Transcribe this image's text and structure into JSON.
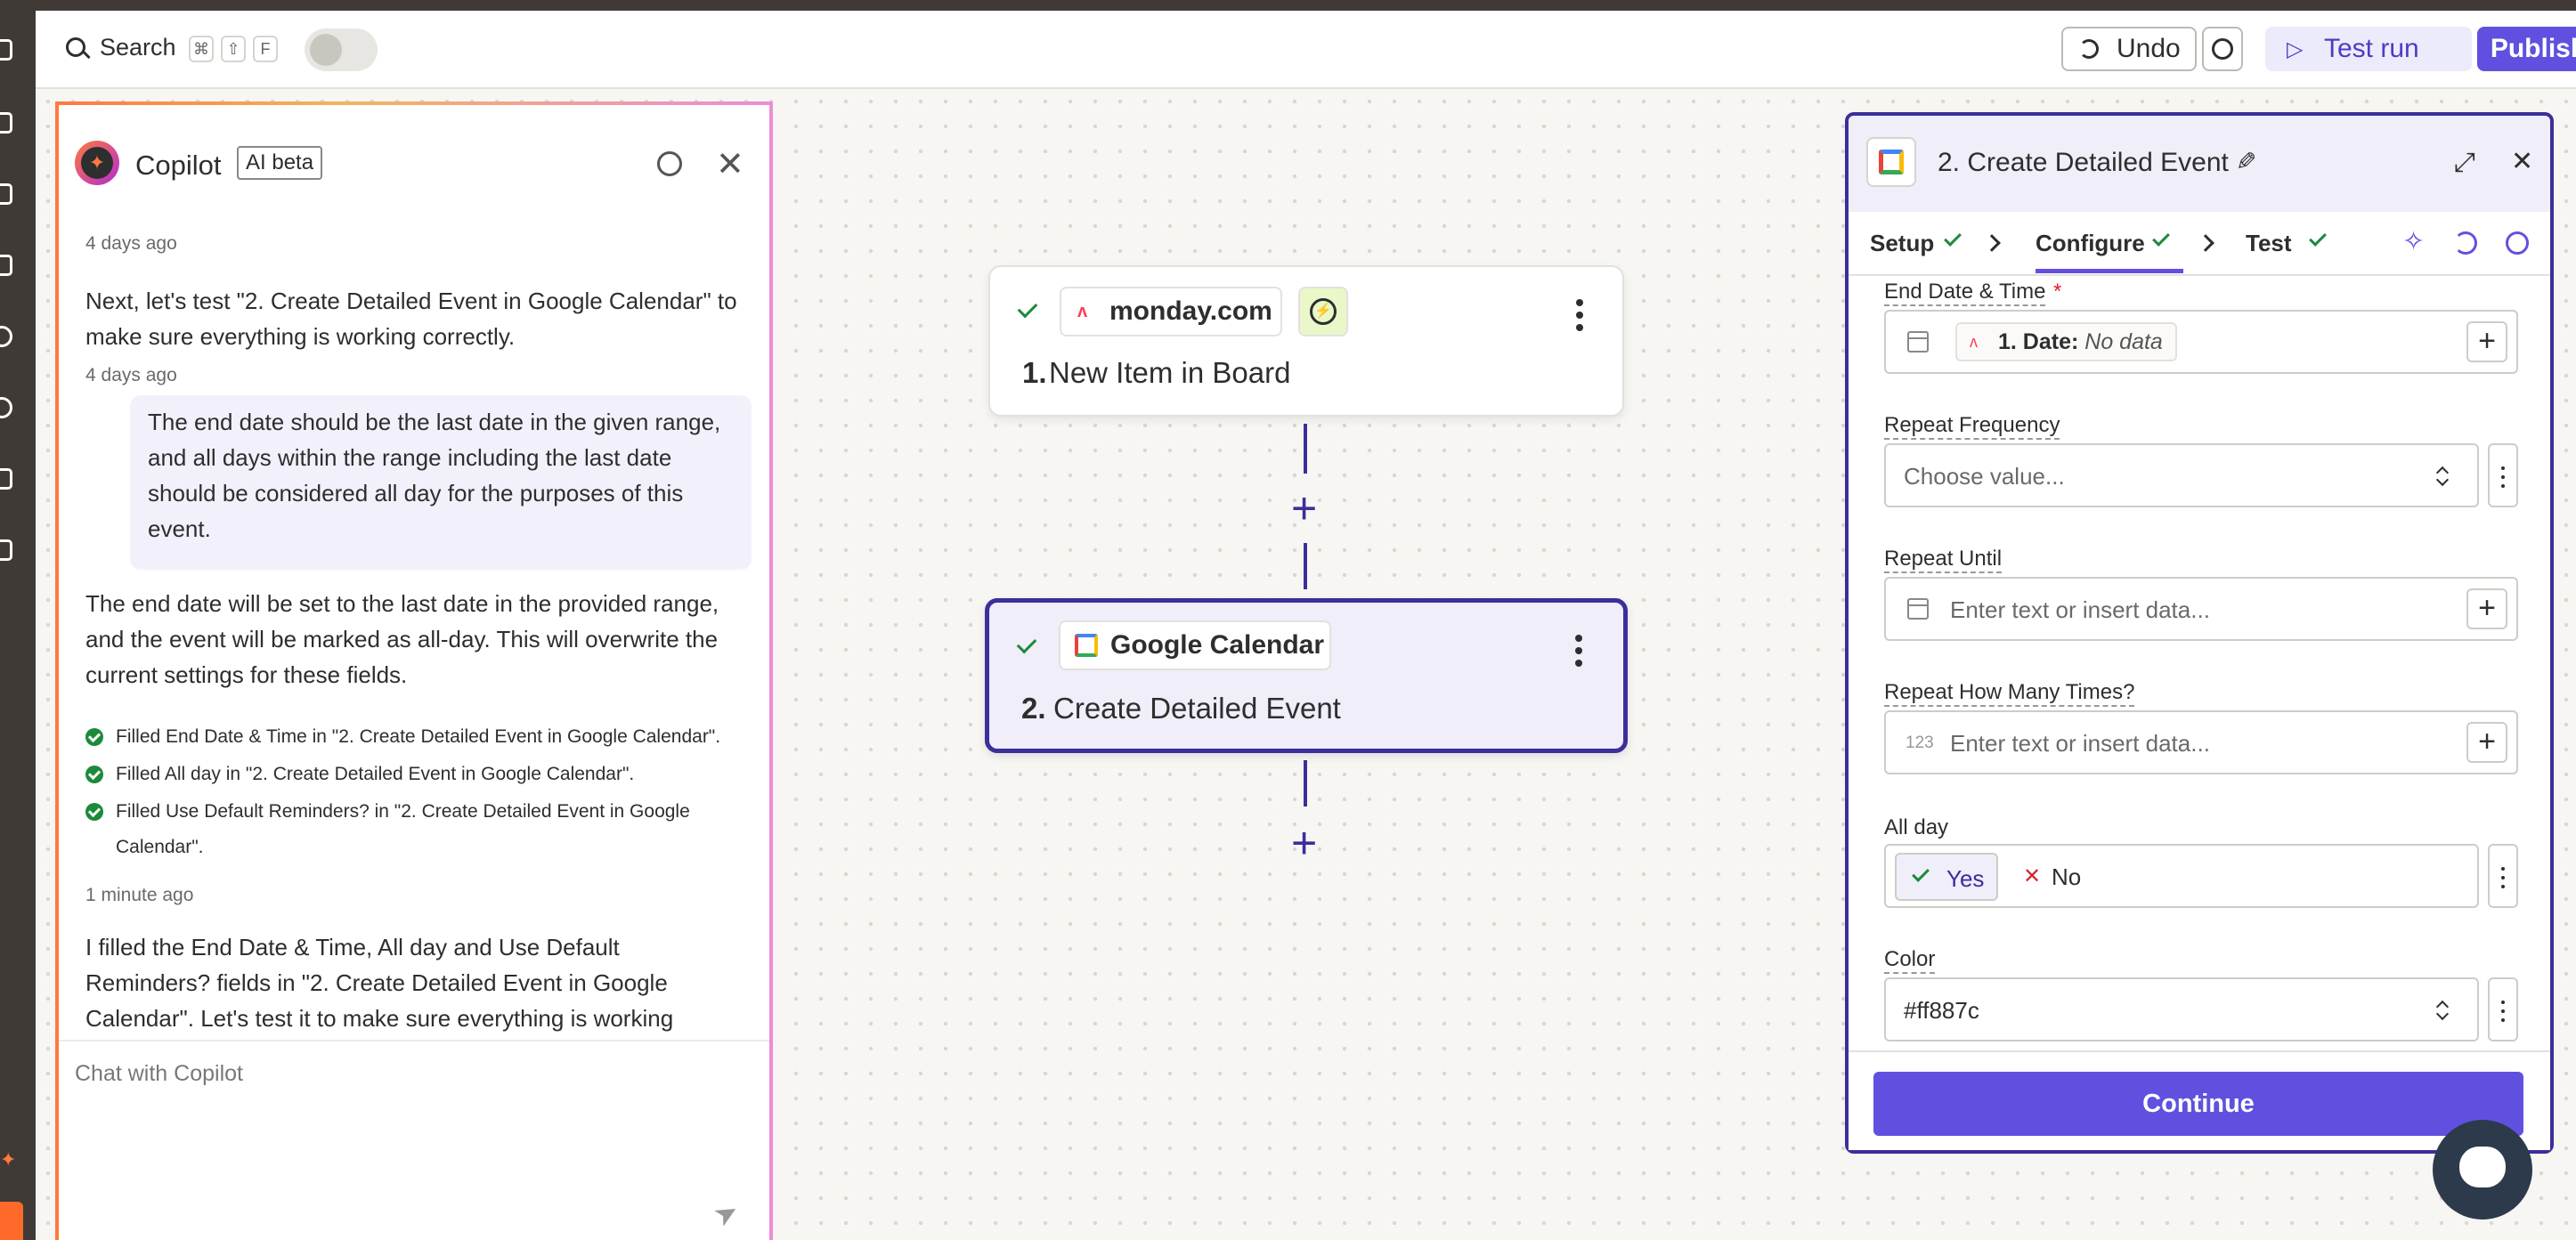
{
  "topbar": {
    "search_label": "Search",
    "shortcut_keys": [
      "⌘",
      "⇧",
      "F"
    ],
    "undo_label": "Undo",
    "test_run_label": "Test run",
    "publish_label": "Publish"
  },
  "copilot": {
    "title": "Copilot",
    "badge": "AI beta",
    "input_placeholder": "Chat with Copilot",
    "messages": [
      {
        "time": "4 days ago"
      },
      {
        "role": "assistant",
        "text": "Next, let's test \"2. Create Detailed Event in Google Calendar\" to make sure everything is working correctly.",
        "time": "4 days ago"
      },
      {
        "role": "user",
        "text": "The end date should be the last date in the given range, and all days within the range including the last date should be considered all day for the purposes of this event."
      },
      {
        "role": "assistant",
        "text": "The end date will be set to the last date in the provided range, and the event will be marked as all-day. This will overwrite the current settings for these fields."
      },
      {
        "role": "assistant",
        "text": "I filled the End Date & Time, All day and Use Default Reminders? fields in \"2. Create Detailed Event in Google Calendar\". Let's test it to make sure everything is working correctly."
      }
    ],
    "filled_items": [
      "Filled End Date & Time in \"2. Create Detailed Event in Google Calendar\".",
      "Filled All day in \"2. Create Detailed Event in Google Calendar\".",
      "Filled Use Default Reminders? in \"2. Create Detailed Event in Google Calendar\"."
    ],
    "filled_time": "1 minute ago"
  },
  "canvas": {
    "nodes": [
      {
        "app": "monday.com",
        "step_num": "1.",
        "step_name": "New Item in Board"
      },
      {
        "app": "Google Calendar",
        "step_num": "2.",
        "step_name": "Create Detailed Event"
      }
    ]
  },
  "panel": {
    "title": "2. Create Detailed Event",
    "tabs": [
      {
        "label": "Setup",
        "done": true
      },
      {
        "label": "Configure",
        "done": true,
        "active": true
      },
      {
        "label": "Test",
        "done": true
      }
    ],
    "fields": {
      "end_date": {
        "label": "End Date & Time",
        "required_mark": "*",
        "chip_label": "1. Date:",
        "chip_value": "No data"
      },
      "repeat_frequency": {
        "label": "Repeat Frequency",
        "placeholder": "Choose value..."
      },
      "repeat_until": {
        "label": "Repeat Until",
        "placeholder": "Enter text or insert data..."
      },
      "repeat_times": {
        "label": "Repeat How Many Times?",
        "type_hint": "123",
        "placeholder": "Enter text or insert data..."
      },
      "all_day": {
        "label": "All day",
        "yes_label": "Yes",
        "no_label": "No",
        "value": "Yes"
      },
      "color": {
        "label": "Color",
        "value": "#ff887c"
      }
    },
    "continue_label": "Continue"
  },
  "colors": {
    "accent": "#3b2f9b",
    "primary_button": "#6150e0",
    "success": "#1c8a3a"
  }
}
